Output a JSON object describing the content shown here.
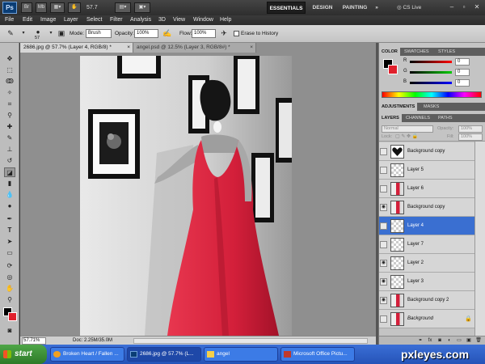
{
  "appbar": {
    "logo": "Ps",
    "btn_br": "Br",
    "btn_mb": "Mb",
    "zoom": "57.7",
    "workspaces": [
      "ESSENTIALS",
      "DESIGN",
      "PAINTING"
    ],
    "more": "»",
    "cs_live": "CS Live",
    "minimize": "–",
    "restore": "▫",
    "close": "✕"
  },
  "menu": [
    "File",
    "Edit",
    "Image",
    "Layer",
    "Select",
    "Filter",
    "Analysis",
    "3D",
    "View",
    "Window",
    "Help"
  ],
  "options": {
    "brush_size": "57",
    "mode_label": "Mode:",
    "mode_value": "Brush",
    "opacity_label": "Opacity:",
    "opacity_value": "100%",
    "flow_label": "Flow:",
    "flow_value": "100%",
    "erase_history": "Erase to History"
  },
  "tabs": [
    {
      "label": "2686.jpg @ 57.7% (Layer 4, RGB/8) *",
      "close": "×"
    },
    {
      "label": "angel.psd @ 12.5% (Layer 3, RGB/8#) *",
      "close": "×"
    }
  ],
  "status": {
    "zoom": "57.71%",
    "doc": "Doc: 2.25M/35.0M"
  },
  "panels": {
    "color_tabs": [
      "COLOR",
      "SWATCHES",
      "STYLES"
    ],
    "color": [
      {
        "channel": "R",
        "value": "0"
      },
      {
        "channel": "G",
        "value": "0"
      },
      {
        "channel": "B",
        "value": "0"
      }
    ],
    "adjust_tabs": [
      "ADJUSTMENTS",
      "MASKS"
    ],
    "layer_tabs": [
      "LAYERS",
      "CHANNELS",
      "PATHS"
    ],
    "blend_mode": "Normal",
    "opacity_label": "Opacity:",
    "opacity_value": "100%",
    "lock_label": "Lock:",
    "fill_label": "Fill:",
    "fill_value": "100%",
    "layers": [
      {
        "name": "Background copy",
        "visible": false,
        "thumb": "heart",
        "selected": false,
        "italic": false
      },
      {
        "name": "Layer 5",
        "visible": false,
        "thumb": "checker",
        "selected": false,
        "italic": false
      },
      {
        "name": "Layer 6",
        "visible": false,
        "thumb": "photo",
        "selected": false,
        "italic": false
      },
      {
        "name": "Background copy",
        "visible": true,
        "thumb": "photo",
        "selected": false,
        "italic": false
      },
      {
        "name": "Layer 4",
        "visible": false,
        "thumb": "checker",
        "selected": true,
        "italic": false
      },
      {
        "name": "Layer 7",
        "visible": false,
        "thumb": "checker",
        "selected": false,
        "italic": false
      },
      {
        "name": "Layer 2",
        "visible": true,
        "thumb": "checker",
        "selected": false,
        "italic": false
      },
      {
        "name": "Layer 3",
        "visible": true,
        "thumb": "checker",
        "selected": false,
        "italic": false
      },
      {
        "name": "Background copy 2",
        "visible": true,
        "thumb": "photo",
        "selected": false,
        "italic": false
      },
      {
        "name": "Background",
        "visible": false,
        "thumb": "photo",
        "selected": false,
        "italic": true
      }
    ]
  },
  "taskbar": {
    "start": "start",
    "tasks": [
      {
        "label": "Broken Heart / Fallen ...",
        "active": false
      },
      {
        "label": "2686.jpg @ 57.7% (L...",
        "active": true
      },
      {
        "label": "angel",
        "active": false
      },
      {
        "label": "Microsoft Office Pictu...",
        "active": false
      }
    ],
    "watermark": "pxleyes.com"
  },
  "icons": {
    "eye": "eye-icon",
    "lock": "lock-icon"
  },
  "colors": {
    "accent": "#3a6fd1",
    "dress": "#d31f3a",
    "background_swatch": "#e0202c"
  }
}
